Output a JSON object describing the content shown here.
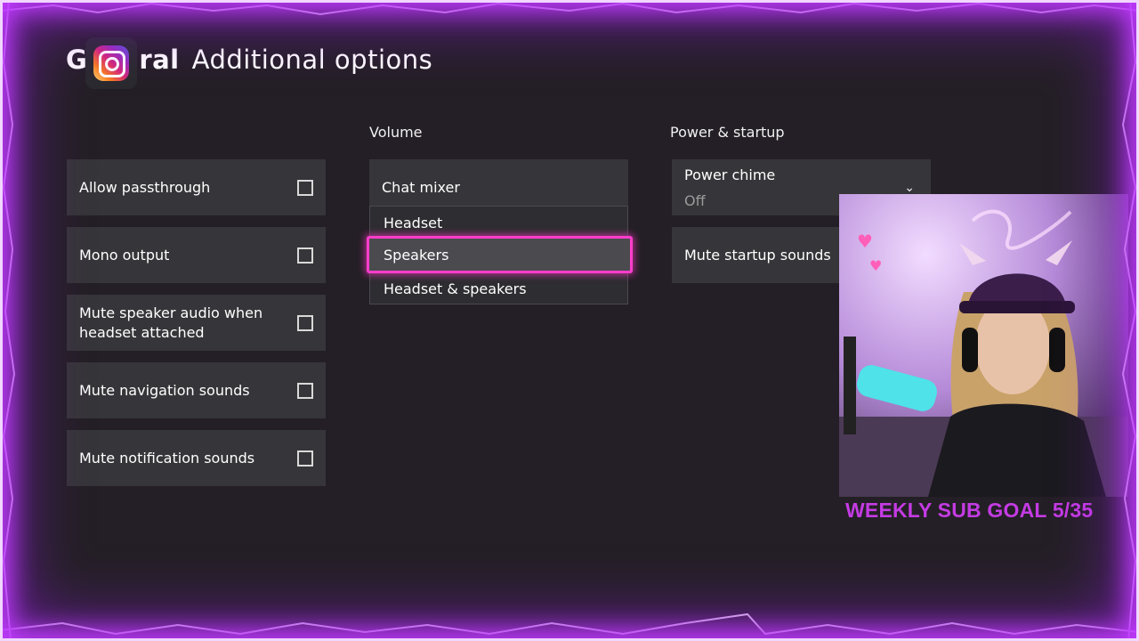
{
  "header": {
    "title_g": "G",
    "title_ral": "ral",
    "title_rest": "Additional options",
    "overlay_icon": "instagram-icon"
  },
  "left_column": {
    "items": [
      {
        "label": "Allow passthrough",
        "checked": false
      },
      {
        "label": "Mono output",
        "checked": false
      },
      {
        "label": "Mute speaker audio when headset attached",
        "checked": false
      },
      {
        "label": "Mute navigation sounds",
        "checked": false
      },
      {
        "label": "Mute notification sounds",
        "checked": false
      }
    ]
  },
  "volume": {
    "header": "Volume",
    "chat_mixer_label": "Chat mixer",
    "options": [
      "Headset",
      "Speakers",
      "Headset & speakers"
    ],
    "selected_option": "Speakers"
  },
  "power": {
    "header": "Power & startup",
    "power_chime_label": "Power chime",
    "power_chime_value": "Off",
    "mute_startup_label": "Mute startup sounds"
  },
  "stream_overlay": {
    "sub_goal_text": "WEEKLY SUB GOAL 5/35",
    "sub_goal_color": "#c43be3",
    "frame_color": "#c23bff"
  },
  "colors": {
    "background": "#241f26",
    "tile": "#363539",
    "focus": "#ff3ecb"
  }
}
